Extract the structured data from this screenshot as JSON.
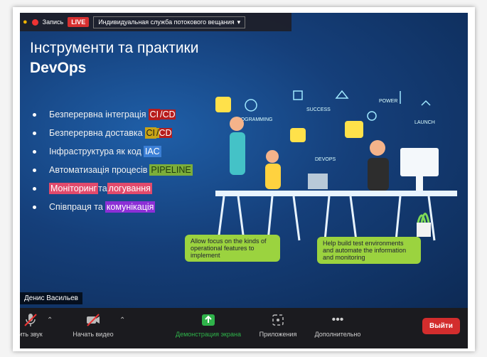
{
  "topbar": {
    "record_label": "Запись",
    "live_label": "LIVE",
    "stream_service": "Индивидуальная служба потокового вещания"
  },
  "slide": {
    "title": "Інструменти та практики",
    "subtitle": "DevOps",
    "bullets": [
      {
        "text": "Безперервна інтеграція",
        "tag1": "CI",
        "sep": "/",
        "tag2": "CD"
      },
      {
        "text": "Безперервна доставка",
        "tag1": "CI",
        "sep": "/",
        "tag2": "CD"
      },
      {
        "text": "Інфраструктура як код",
        "tag1": "IAC"
      },
      {
        "text": "Автоматизація процесів",
        "tag1": "PIPELINE"
      },
      {
        "t1": "Моніторинг",
        "mid": " та ",
        "t2": "логування"
      },
      {
        "text": "Співпраця та",
        "tag1": "комунікація"
      }
    ],
    "illustration_labels": {
      "success": "SUCCESS",
      "devops": "DEVOPS",
      "power": "POWER",
      "launch": "LAUNCH",
      "programming": "PROGRAMMING"
    },
    "note_left": "Allow focus on the kinds of operational features to implement",
    "note_right": "Help build test environments and automate the information and monitoring"
  },
  "participant_name": "Денис Васильев",
  "toolbar": {
    "mute_label": "ить звук",
    "video_label": "Начать видео",
    "share_label": "Демонстрация экрана",
    "apps_label": "Приложения",
    "more_label": "Дополнительно",
    "leave_label": "Выйти"
  },
  "colors": {
    "share_green": "#2fb34a",
    "leave_red": "#d32d2d",
    "live_red": "#d73030",
    "slide_blue": "#153f7a"
  }
}
